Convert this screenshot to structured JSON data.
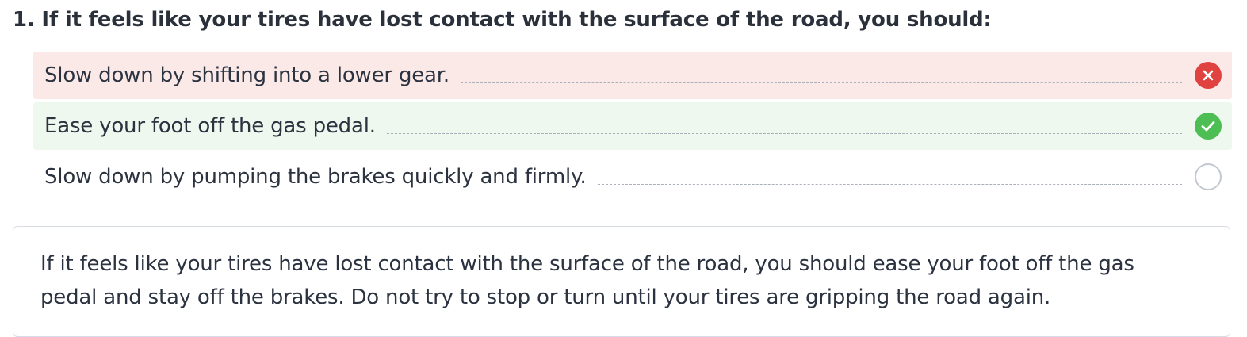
{
  "question": {
    "title": "1. If it feels like your tires have lost contact with the surface of the road, you should:"
  },
  "answers": [
    {
      "text": "Slow down by shifting into a lower gear.",
      "state": "incorrect",
      "icon": "x-icon"
    },
    {
      "text": "Ease your foot off the gas pedal.",
      "state": "correct",
      "icon": "check-icon"
    },
    {
      "text": "Slow down by pumping the brakes quickly and firmly.",
      "state": "unselected",
      "icon": "empty-circle-icon"
    }
  ],
  "explanation": {
    "text": "If it feels like your tires have lost contact with the surface of the road, you should ease your foot off the gas pedal and stay off the brakes. Do not try to stop or turn until your tires are gripping the road again."
  },
  "colors": {
    "incorrect_bg": "#fbe9e8",
    "incorrect_icon": "#e0433f",
    "correct_bg": "#eef8ee",
    "correct_icon": "#4cbe54",
    "text": "#2c3340"
  }
}
